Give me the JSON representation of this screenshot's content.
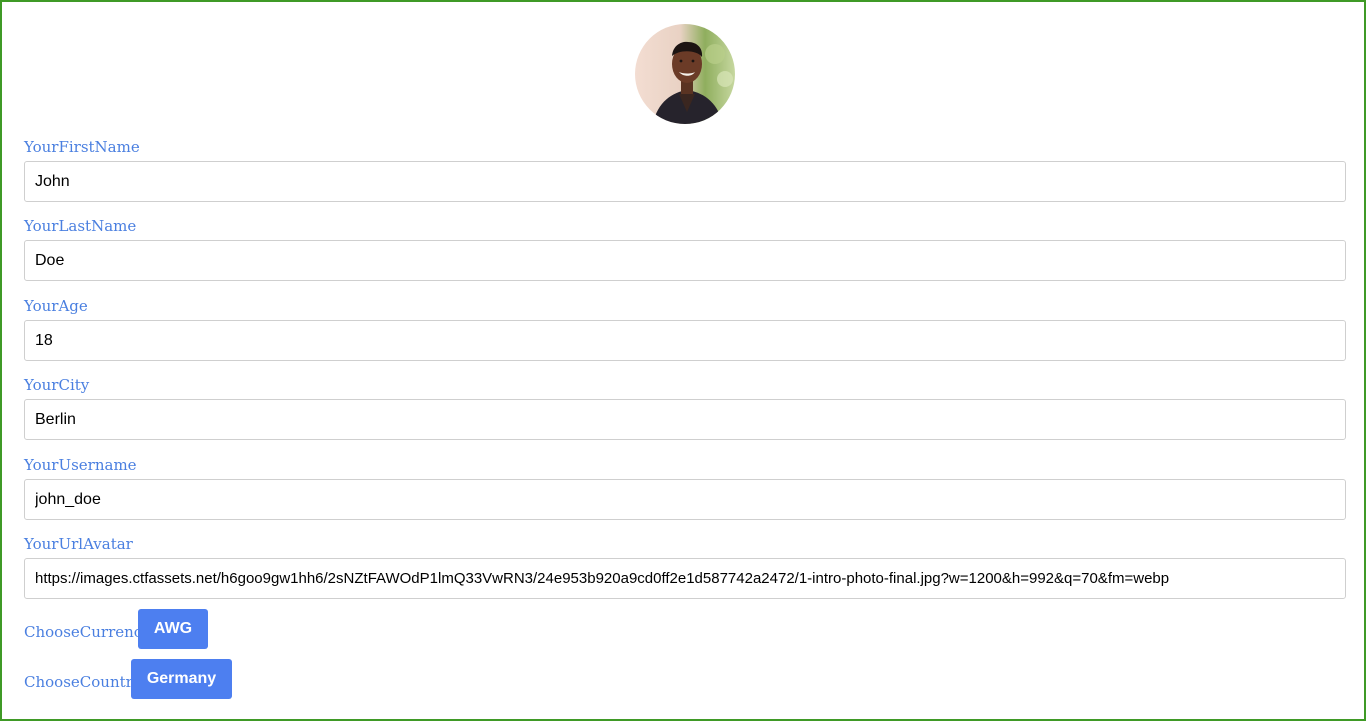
{
  "avatar": {
    "alt": "profile photo"
  },
  "fields": {
    "first_name": {
      "label": "YourFirstName",
      "value": "John"
    },
    "last_name": {
      "label": "YourLastName",
      "value": "Doe"
    },
    "age": {
      "label": "YourAge",
      "value": "18"
    },
    "city": {
      "label": "YourCity",
      "value": "Berlin"
    },
    "username": {
      "label": "YourUsername",
      "value": "john_doe"
    },
    "url_avatar": {
      "label": "YourUrlAvatar",
      "value": "https://images.ctfassets.net/h6goo9gw1hh6/2sNZtFAWOdP1lmQ33VwRN3/24e953b920a9cd0ff2e1d587742a2472/1-intro-photo-final.jpg?w=1200&h=992&q=70&fm=webp"
    }
  },
  "currency": {
    "label": "ChooseCurrency",
    "selected": "AWG"
  },
  "country": {
    "label": "ChooseCountry",
    "selected": "Germany"
  },
  "colors": {
    "accent": "#4d7ff0",
    "label": "#4a7fe0",
    "frame_border": "#3f9a26"
  }
}
